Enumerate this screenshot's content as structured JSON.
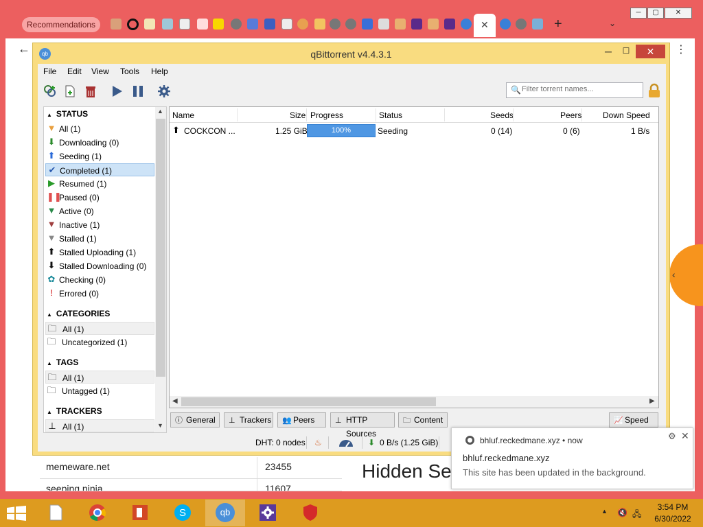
{
  "browser": {
    "recommendations_label": "Recommendations",
    "close_tab_glyph": "✕",
    "new_tab_glyph": "+",
    "tab_search_glyph": "⌄",
    "back_glyph": "←",
    "menu_glyph": "⋮",
    "minimize_glyph": "─",
    "maximize_glyph": "▢",
    "close_glyph": "✕"
  },
  "background_page": {
    "rows": [
      {
        "site": "memeware.net",
        "value": "23455"
      },
      {
        "site": "seeping.ninja",
        "value": "11607"
      }
    ],
    "heading": "Hidden Se",
    "arrow_glyph": "‹"
  },
  "qbittorrent": {
    "title": "qBittorrent v4.4.3.1",
    "logo_text": "qb",
    "min_glyph": "─",
    "max_glyph": "☐",
    "close_glyph": "✕",
    "menu": [
      "File",
      "Edit",
      "View",
      "Tools",
      "Help"
    ],
    "search_placeholder": "Filter torrent names...",
    "search_icon_glyph": "🔍",
    "sidebar": {
      "status_header": "STATUS",
      "status_items": [
        {
          "label": "All (1)",
          "icon": "filter-all-icon",
          "glyph": "▼",
          "color": "#e9a040"
        },
        {
          "label": "Downloading (0)",
          "icon": "download-arrow-icon",
          "glyph": "⬇",
          "color": "#2a8a2a"
        },
        {
          "label": "Seeding (1)",
          "icon": "upload-arrow-icon",
          "glyph": "⬆",
          "color": "#2a6ad8"
        },
        {
          "label": "Completed (1)",
          "icon": "checkmark-icon",
          "glyph": "✔",
          "color": "#2a5ab0"
        },
        {
          "label": "Resumed (1)",
          "icon": "play-icon",
          "glyph": "▶",
          "color": "#2a9a2a"
        },
        {
          "label": "Paused (0)",
          "icon": "pause-icon",
          "glyph": "❚❚",
          "color": "#e05050"
        },
        {
          "label": "Active (0)",
          "icon": "filter-active-icon",
          "glyph": "▼",
          "color": "#2a8a4a"
        },
        {
          "label": "Inactive (1)",
          "icon": "filter-inactive-icon",
          "glyph": "▼",
          "color": "#a04040"
        },
        {
          "label": "Stalled (1)",
          "icon": "filter-stalled-icon",
          "glyph": "▼",
          "color": "#888888"
        },
        {
          "label": "Stalled Uploading (1)",
          "icon": "stalled-upload-icon",
          "glyph": "⬆",
          "color": "#111111"
        },
        {
          "label": "Stalled Downloading (0)",
          "icon": "stalled-download-icon",
          "glyph": "⬇",
          "color": "#111111"
        },
        {
          "label": "Checking (0)",
          "icon": "checking-gear-icon",
          "glyph": "✿",
          "color": "#1a8a9a"
        },
        {
          "label": "Errored (0)",
          "icon": "error-exclamation-icon",
          "glyph": "!",
          "color": "#d01010"
        }
      ],
      "categories_header": "CATEGORIES",
      "category_items": [
        "All (1)",
        "Uncategorized (1)"
      ],
      "tags_header": "TAGS",
      "tag_items": [
        "All (1)",
        "Untagged (1)"
      ],
      "trackers_header": "TRACKERS",
      "tracker_items": [
        "All (1)"
      ]
    },
    "columns": [
      "Name",
      "Size",
      "Progress",
      "Status",
      "Seeds",
      "Peers",
      "Down Speed"
    ],
    "torrents": [
      {
        "name": "COCKCON ...",
        "size": "1.25 GiB",
        "progress": "100%",
        "progress_fraction": 1.0,
        "status": "Seeding",
        "seeds": "0 (14)",
        "peers": "0 (6)",
        "down_speed": "1 B/s"
      }
    ],
    "bottom_tabs": [
      "General",
      "Trackers",
      "Peers",
      "HTTP Sources",
      "Content"
    ],
    "speed_tab": "Speed",
    "statusbar": {
      "dht": "DHT: 0 nodes",
      "download": "0 B/s (1.25 GiB)"
    }
  },
  "notification": {
    "source": "bhluf.reckedmane.xyz  •  now",
    "title": "bhluf.reckedmane.xyz",
    "message": "This site has been updated in the background.",
    "gear_glyph": "⚙",
    "close_glyph": "✕"
  },
  "taskbar": {
    "time": "3:54 PM",
    "date": "6/30/2022",
    "qb_label": "qb"
  }
}
